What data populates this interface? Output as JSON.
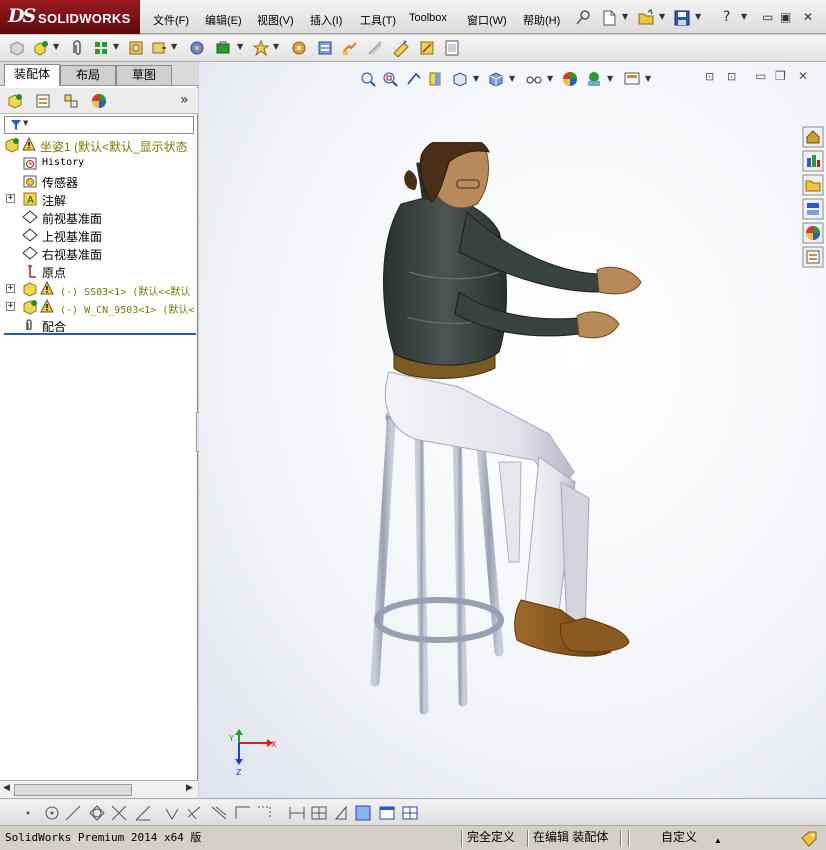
{
  "app": {
    "logo_mark": "DS",
    "logo_text": "SOLIDWORKS"
  },
  "menu": {
    "items": [
      "文件(F)",
      "编辑(E)",
      "视图(V)",
      "插入(I)",
      "工具(T)",
      "Toolbox",
      "窗口(W)",
      "帮助(H)"
    ],
    "help_symbol": "?"
  },
  "tabs": [
    "装配体",
    "布局",
    "草图"
  ],
  "tree": {
    "root_label": "坐姿1  (默认<默认_显示状态",
    "items": [
      {
        "label": "History",
        "icon": "history-icon"
      },
      {
        "label": "传感器",
        "icon": "sensor-icon"
      },
      {
        "label": "注解",
        "icon": "annotation-icon"
      },
      {
        "label": "前视基准面",
        "icon": "plane-icon"
      },
      {
        "label": "上视基准面",
        "icon": "plane-icon"
      },
      {
        "label": "右视基准面",
        "icon": "plane-icon"
      },
      {
        "label": "原点",
        "icon": "origin-icon"
      },
      {
        "label": "(-) SS03<1> (默认<<默认",
        "icon": "part-icon"
      },
      {
        "label": "(-) W_CN_9503<1> (默认<",
        "icon": "part-icon"
      },
      {
        "label": "配合",
        "icon": "mate-icon"
      }
    ]
  },
  "triad": {
    "x_label": "X",
    "y_label": "Y",
    "z_label": "Z"
  },
  "status": {
    "product": "SolidWorks Premium 2014 x64 版",
    "definition": "完全定义",
    "mode": "在编辑 装配体",
    "units": "自定义"
  },
  "colors": {
    "logo_bg": "#8b1a1d",
    "tree_separator": "#1f5fb0",
    "jacket": "#3a4240",
    "pants": "#e8e8ee",
    "skin": "#b88a5a",
    "shoes": "#8a5a20",
    "stool": "#a8aec0"
  }
}
